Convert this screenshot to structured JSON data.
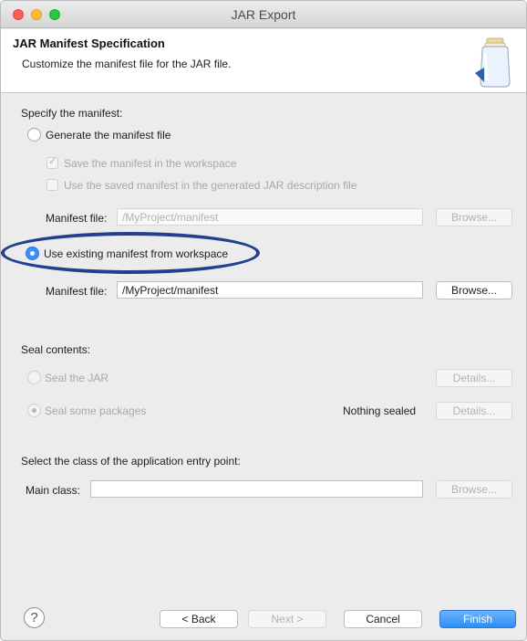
{
  "window": {
    "title": "JAR Export"
  },
  "header": {
    "title": "JAR Manifest Specification",
    "subtitle": "Customize the manifest file for the JAR file."
  },
  "manifest": {
    "section_label": "Specify the manifest:",
    "generate_label": "Generate the manifest file",
    "save_in_workspace_label": "Save the manifest in the workspace",
    "use_saved_label": "Use the saved manifest in the generated JAR description file",
    "manifest_file_label": "Manifest file:",
    "generate_file_value": "/MyProject/manifest",
    "browse_label": "Browse...",
    "use_existing_label": "Use existing manifest from workspace",
    "existing_file_value": "/MyProject/manifest"
  },
  "seal": {
    "section_label": "Seal contents:",
    "seal_jar_label": "Seal the JAR",
    "seal_packages_label": "Seal some packages",
    "nothing_sealed_label": "Nothing sealed",
    "details_label": "Details..."
  },
  "entry": {
    "section_label": "Select the class of the application entry point:",
    "main_class_label": "Main class:",
    "main_class_value": "",
    "browse_label": "Browse..."
  },
  "footer": {
    "help_glyph": "?",
    "back_label": "< Back",
    "next_label": "Next >",
    "cancel_label": "Cancel",
    "finish_label": "Finish"
  },
  "colors": {
    "accent": "#3d8ef7",
    "highlight_ring": "#23408f"
  },
  "icons": {
    "header": "jar-icon",
    "help": "help-icon"
  }
}
